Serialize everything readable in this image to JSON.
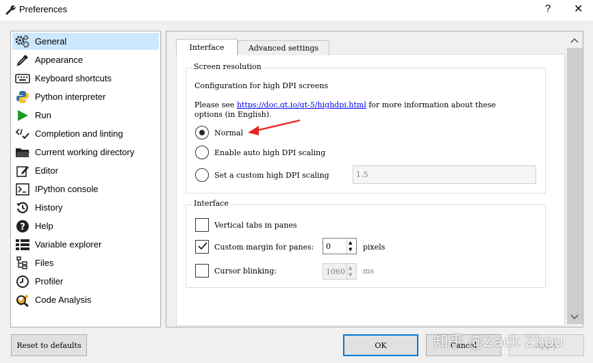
{
  "window": {
    "title": "Preferences",
    "help_glyph": "?",
    "close_glyph": "✕"
  },
  "sidebar": {
    "items": [
      {
        "label": "General",
        "icon": "gears-icon",
        "selected": true
      },
      {
        "label": "Appearance",
        "icon": "eyedropper-icon"
      },
      {
        "label": "Keyboard shortcuts",
        "icon": "keyboard-icon"
      },
      {
        "label": "Python interpreter",
        "icon": "python-icon"
      },
      {
        "label": "Run",
        "icon": "play-icon"
      },
      {
        "label": "Completion and linting",
        "icon": "completion-icon"
      },
      {
        "label": "Current working directory",
        "icon": "folder-icon"
      },
      {
        "label": "Editor",
        "icon": "edit-icon"
      },
      {
        "label": "IPython console",
        "icon": "terminal-icon"
      },
      {
        "label": "History",
        "icon": "history-icon"
      },
      {
        "label": "Help",
        "icon": "help-icon"
      },
      {
        "label": "Variable explorer",
        "icon": "list-icon"
      },
      {
        "label": "Files",
        "icon": "files-icon"
      },
      {
        "label": "Profiler",
        "icon": "clock-icon"
      },
      {
        "label": "Code Analysis",
        "icon": "code-analysis-icon"
      }
    ]
  },
  "tabs": [
    {
      "label": "Interface",
      "active": true
    },
    {
      "label": "Advanced settings",
      "active": false
    }
  ],
  "screen_resolution": {
    "title": "Screen resolution",
    "config_text": "Configuration for high DPI screens",
    "info_prefix": "Please see ",
    "info_link": "https://doc.qt.io/qt-5/highdpi.html",
    "info_suffix": " for more information about these",
    "info_line2": "options (in English).",
    "options": [
      {
        "label": "Normal",
        "checked": true
      },
      {
        "label": "Enable auto high DPI scaling",
        "checked": false
      },
      {
        "label": "Set a custom high DPI scaling",
        "checked": false
      }
    ],
    "custom_value": "1.5"
  },
  "interface": {
    "title": "Interface",
    "vertical_tabs_label": "Vertical tabs in panes",
    "vertical_tabs_checked": false,
    "custom_margin_label": "Custom margin for panes:",
    "custom_margin_checked": true,
    "custom_margin_value": "0",
    "custom_margin_unit": "pixels",
    "cursor_blinking_label": "Cursor blinking:",
    "cursor_blinking_checked": false,
    "cursor_blinking_value": "1060",
    "cursor_blinking_unit": "ms"
  },
  "buttons": {
    "reset": "Reset to defaults",
    "ok": "OK",
    "cancel": "Cancel",
    "apply": "Apply"
  },
  "watermark": "知乎 @Zack Zhou",
  "colors": {
    "selection": "#cce8ff",
    "accent": "#0078d7",
    "annotation_arrow": "#e8281e",
    "link": "#0000ee"
  }
}
